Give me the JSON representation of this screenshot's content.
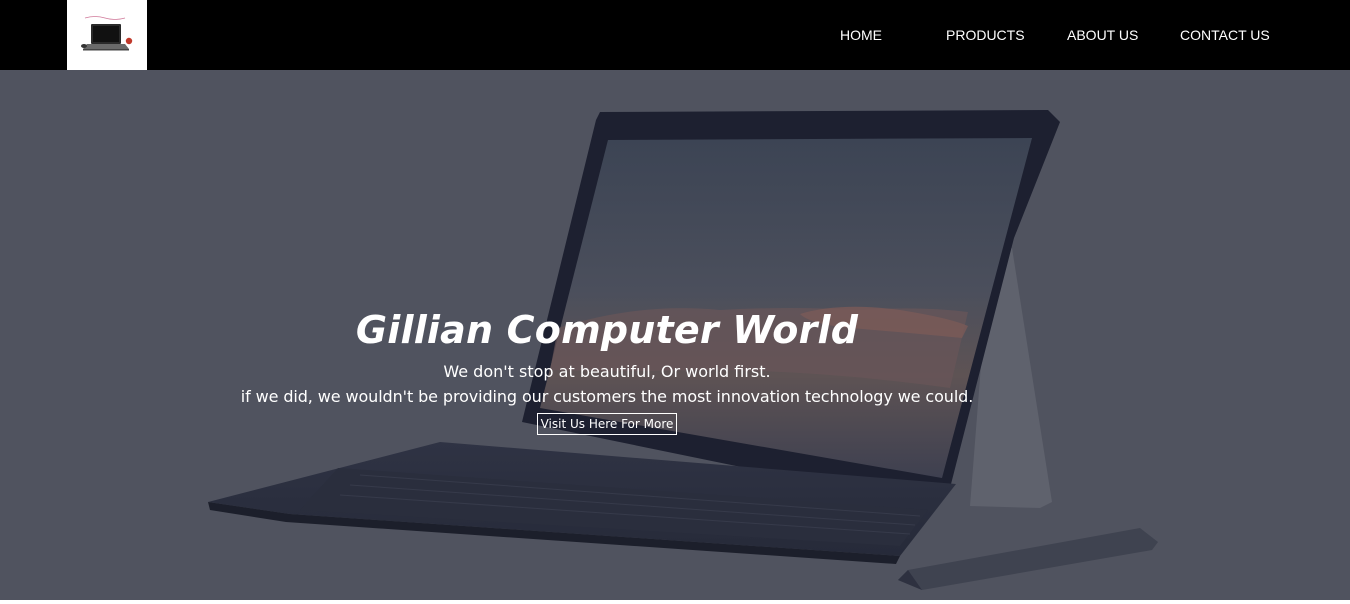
{
  "header": {
    "logo_icon": "laptop-logo-icon",
    "nav": {
      "home": "HOME",
      "products": "PRODUCTS",
      "about": "ABOUT US",
      "contact": "CONTACT US"
    }
  },
  "hero": {
    "title": "Gillian Computer World",
    "line1": "We don't stop at beautiful, Or world first.",
    "line2": "if we did, we wouldn't be providing our customers the most innovation technology we could.",
    "button_label": "Visit Us Here For More",
    "background_image": "laptop-with-stylus-image"
  },
  "colors": {
    "navbar": "#000000",
    "hero_overlay": "#50535f",
    "text": "#ffffff"
  }
}
